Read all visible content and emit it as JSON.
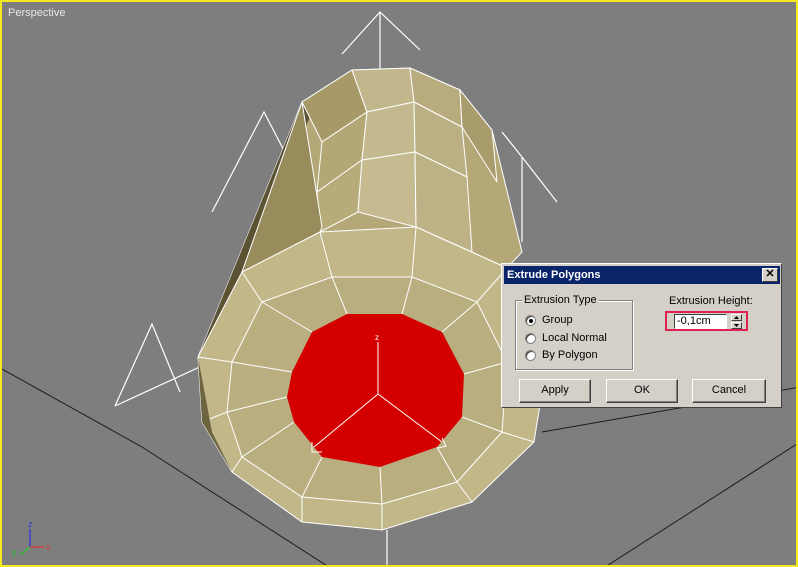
{
  "viewport": {
    "label": "Perspective",
    "border_color": "#f5e81f",
    "background": "#7e7e7e",
    "axis_labels": {
      "z": "z",
      "y": "y",
      "x": "x"
    },
    "selection_color": "#d40000",
    "mesh_color": "#bcb185"
  },
  "dialog": {
    "title": "Extrude Polygons",
    "close_icon": "close-icon",
    "extrusion_type": {
      "legend": "Extrusion Type",
      "options": [
        {
          "label": "Group",
          "checked": true
        },
        {
          "label": "Local Normal",
          "checked": false
        },
        {
          "label": "By Polygon",
          "checked": false
        }
      ]
    },
    "extrusion_height": {
      "label": "Extrusion Height:",
      "value": "-0,1cm",
      "highlight_color": "#e0204e"
    },
    "buttons": {
      "apply": "Apply",
      "ok": "OK",
      "cancel": "Cancel"
    }
  }
}
